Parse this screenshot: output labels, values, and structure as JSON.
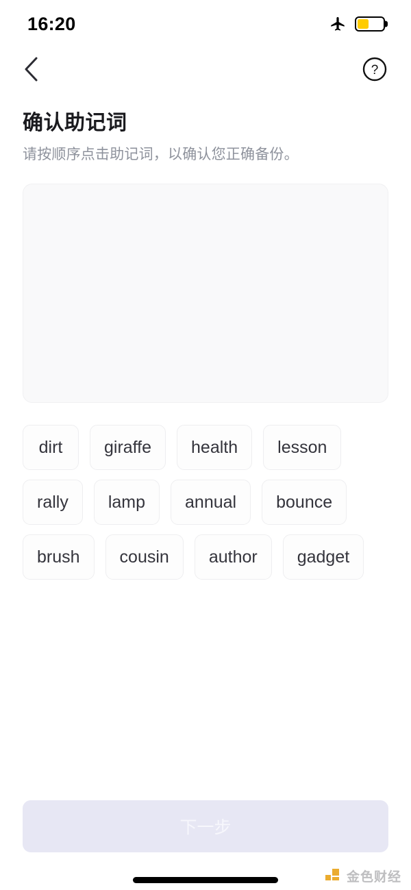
{
  "status_bar": {
    "time": "16:20",
    "airplane_icon": "airplane-icon",
    "battery_icon": "battery-icon",
    "battery_fill_percent": 45,
    "battery_color": "#ffcc00"
  },
  "nav": {
    "back_icon": "chevron-left-icon",
    "help_icon": "question-mark-circle-icon"
  },
  "header": {
    "title": "确认助记词",
    "subtitle": "请按顺序点击助记词，以确认您正确备份。"
  },
  "answer_panel": {
    "selected_words": [],
    "background_color": "#f9f9fa"
  },
  "word_bank": {
    "words": [
      "dirt",
      "giraffe",
      "health",
      "lesson",
      "rally",
      "lamp",
      "annual",
      "bounce",
      "brush",
      "cousin",
      "author",
      "gadget"
    ]
  },
  "footer": {
    "next_label": "下一步",
    "next_enabled": false,
    "next_background": "#e7e7f4",
    "next_text_color": "#f7f7fc"
  },
  "watermark": {
    "text": "金色财经",
    "logo_color": "#eaa51e"
  }
}
